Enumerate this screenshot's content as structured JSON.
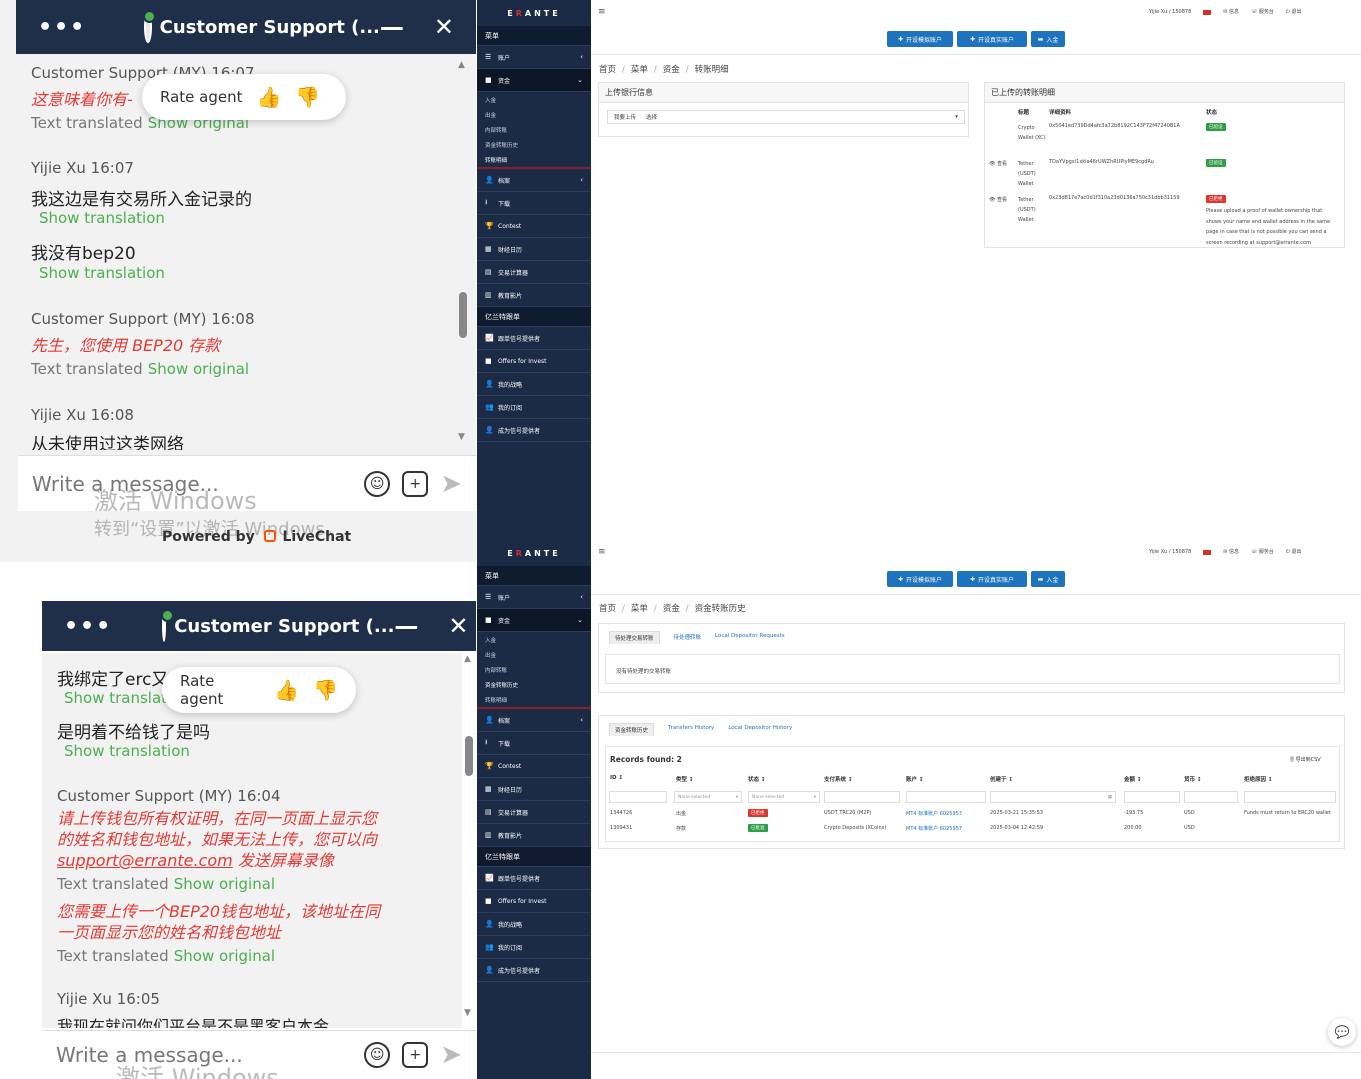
{
  "chat_top": {
    "title": "Customer Support (...",
    "messages": [
      {
        "meta": "Customer Support (MY) 16:07",
        "red": "这意味着你有-",
        "translated": "Text translated",
        "show_original": "Show original"
      },
      {
        "meta": "Yijie Xu 16:07",
        "body": "我这边是有交易所入金记录的",
        "show_translation": "Show translation"
      },
      {
        "body": "我没有bep20",
        "show_translation": "Show translation"
      },
      {
        "meta": "Customer Support (MY) 16:08",
        "red": "先生，您使用 BEP20 存款",
        "translated": "Text translated",
        "show_original": "Show original"
      },
      {
        "meta": "Yijie Xu 16:08",
        "body": "从未使用过这类网络"
      }
    ],
    "rate_agent": "Rate agent",
    "placeholder": "Write a message...",
    "watermark1": "激活 Windows",
    "watermark2": "转到“设置”以激活 Windows。",
    "powered_by": "Powered by",
    "brand": "LiveChat"
  },
  "chat_bottom": {
    "title": "Customer Support (...",
    "messages": [
      {
        "body": "我绑定了erc又",
        "show_translation": "Show translatio"
      },
      {
        "body": "是明着不给钱了是吗",
        "show_translation": "Show translation"
      },
      {
        "meta": "Customer Support (MY) 16:04",
        "red1": "请上传钱包所有权证明，在同一页面上显示您",
        "red2": "的姓名和钱包地址，如果无法上传，您可以向",
        "red3_link": "support@errante.com",
        "red3_rest": " 发送屏幕录像",
        "translated": "Text translated",
        "show_original": "Show original"
      },
      {
        "red1": "您需要上传一个BEP20钱包地址，该地址在同",
        "red2": "一页面显示您的姓名和钱包地址",
        "translated": "Text translated",
        "show_original": "Show original"
      },
      {
        "meta": "Yijie Xu 16:05",
        "body": "我现在就问你们平台是不是黑客户本金"
      }
    ],
    "rate_agent": "Rate agent",
    "placeholder": "Write a message...",
    "watermark1": "激活 Windows"
  },
  "sidebar": {
    "logo_a": "E",
    "logo_b": "R",
    "logo_c": "ANTE",
    "menu": "菜单",
    "items": [
      "账户",
      "资金"
    ],
    "subitems": [
      "入金",
      "出金",
      "内部转账",
      "资金转账历史",
      "转账明细"
    ],
    "items2": [
      "档案",
      "下载",
      "Contest",
      "财经日历",
      "交易计算器",
      "教育影片"
    ],
    "section2": "亿兰特跟单",
    "items3": [
      "跟单信号提供者",
      "Offers for Invest",
      "我的战略",
      "我的订阅",
      "成为信号提供者"
    ]
  },
  "header": {
    "user": "Yijie Xu / 150878",
    "links": [
      "信息",
      "服务台",
      "退出"
    ],
    "buttons": [
      "开设模拟账户",
      "开设真实账户",
      "入金"
    ]
  },
  "page1": {
    "breadcrumb": [
      "首页",
      "菜单",
      "资金",
      "转账明细"
    ],
    "upload_title": "上传银行信息",
    "select_label": "我要上传",
    "select_value": "选择",
    "uploaded_title": "已上传的转账明细",
    "cols": [
      "标题",
      "详细资料",
      "状态"
    ],
    "rows": [
      {
        "view": "",
        "title": "Crypto Wallet (XC)",
        "detail": "0x5041ed739Dd4afc3a72b8192C143F72f47240B1A",
        "status": "已验证",
        "status_color": "#2e9e48"
      },
      {
        "view": "查看",
        "title": "Tether (USDT) Wallet",
        "detail": "TDaYVpgxi1xkia46rUWZhRUPiyME9cgdRu",
        "status": "已验证",
        "status_color": "#2e9e48"
      },
      {
        "view": "查看",
        "title": "Tether (USDT) Wallet",
        "detail": "0x23d817e7ac0d1f310a23d0136a750c31dbb31159",
        "status": "已拒绝",
        "status_color": "#d9372f",
        "note": [
          "Please upload a proof of wallet ownership that",
          "shows your name and wallet address in the same",
          "page in case that is not possible you can send a",
          "screen recording at support@errante.com"
        ]
      }
    ]
  },
  "page2": {
    "breadcrumb": [
      "首页",
      "菜单",
      "资金",
      "资金转账历史"
    ],
    "tabs1": [
      "待处理交易转账",
      "待处理转账",
      "Local Depositor Requests"
    ],
    "pending_empty": "没有待处理的交易转账",
    "tabs2": [
      "资金转账历史",
      "Transfers History",
      "Local Depositor History"
    ],
    "records": "Records found: 2",
    "export": "导出到CSV",
    "cols": [
      "ID",
      "类型",
      "状态",
      "支付系统",
      "账户",
      "创建于",
      "金额",
      "货币",
      "拒绝原因"
    ],
    "filter_none": "None selected",
    "rows": [
      {
        "id": "1344726",
        "type": "出金",
        "status": "已拒绝",
        "status_color": "#d9372f",
        "system": "USDT TRC20 (M2P)",
        "account": "MT4 标准账户 6025957",
        "created": "2025-03-21 15:35:53",
        "amount": "-193.75",
        "currency": "USD",
        "reason": "Funds must return to ERC20 wallet"
      },
      {
        "id": "1309431",
        "type": "存款",
        "status": "已批准",
        "status_color": "#2e9e48",
        "system": "Crypto Deposits (XCoins)",
        "account": "MT4 标准账户 6025957",
        "created": "2025-03-04 12:42:59",
        "amount": "200.00",
        "currency": "USD",
        "reason": ""
      }
    ]
  }
}
